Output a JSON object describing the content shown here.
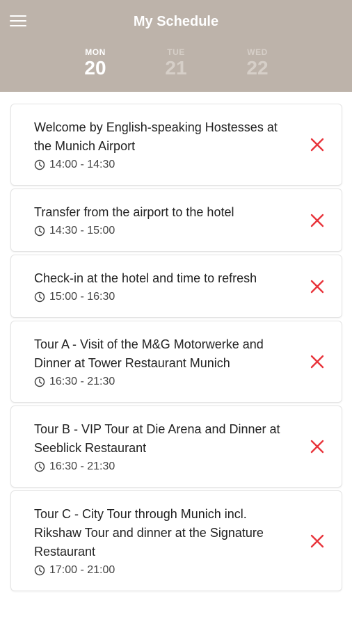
{
  "header": {
    "title": "My Schedule",
    "background": "#bdb3aa"
  },
  "days": [
    {
      "name": "MON",
      "num": "20",
      "active": true
    },
    {
      "name": "TUE",
      "num": "21",
      "active": false
    },
    {
      "name": "WED",
      "num": "22",
      "active": false
    }
  ],
  "events": [
    {
      "title": "Welcome by English-speaking Hostesses at the Munich Airport",
      "time": "14:00 - 14:30"
    },
    {
      "title": "Transfer from the airport to the hotel",
      "time": "14:30 - 15:00"
    },
    {
      "title": "Check-in at the hotel and time to refresh",
      "time": "15:00 - 16:30"
    },
    {
      "title": "Tour A - Visit of the M&G Motorwerke and Dinner at Tower Restaurant Munich",
      "time": "16:30 - 21:30"
    },
    {
      "title": "Tour B - VIP Tour at Die Arena and Dinner at Seeblick Restaurant",
      "time": "16:30 - 21:30"
    },
    {
      "title": "Tour C - City Tour through Munich incl. Rikshaw Tour and dinner at the Signature Restaurant",
      "time": "17:00 - 21:00"
    }
  ],
  "icons": {
    "menu": "hamburger-menu-icon",
    "clock": "clock-icon",
    "remove": "close-x-icon"
  },
  "colors": {
    "accent_remove": "#e8333a"
  }
}
